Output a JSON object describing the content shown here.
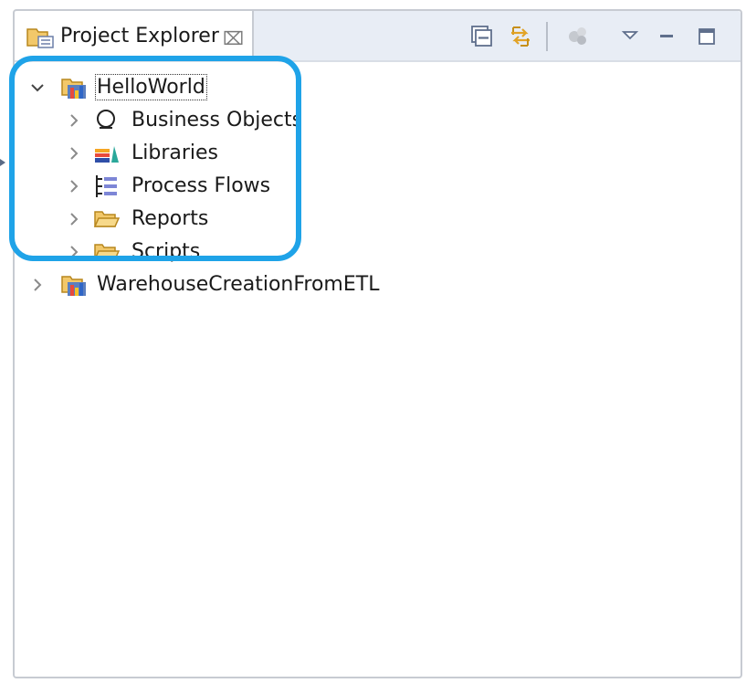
{
  "view": {
    "title": "Project Explorer",
    "close_glyph": "⌧",
    "toolbar": {
      "collapse_all": "collapse-all-icon",
      "link_with_editor": "link-with-editor-icon",
      "filters": "filters-icon",
      "view_menu": "view-menu-icon",
      "minimize": "minimize-icon",
      "maximize": "maximize-icon"
    }
  },
  "tree": {
    "projects": [
      {
        "label": "HelloWorld",
        "expanded": true,
        "children": [
          {
            "label": "Business Objects",
            "icon": "business-objects-icon"
          },
          {
            "label": "Libraries",
            "icon": "libraries-icon"
          },
          {
            "label": "Process Flows",
            "icon": "process-flows-icon"
          },
          {
            "label": "Reports",
            "icon": "folder-icon"
          },
          {
            "label": "Scripts",
            "icon": "folder-icon"
          }
        ]
      },
      {
        "label": "WarehouseCreationFromETL",
        "expanded": false
      }
    ]
  },
  "colors": {
    "highlight": "#1fa3e8",
    "tabbar": "#e8edf5",
    "folder": "#f2c86a"
  }
}
